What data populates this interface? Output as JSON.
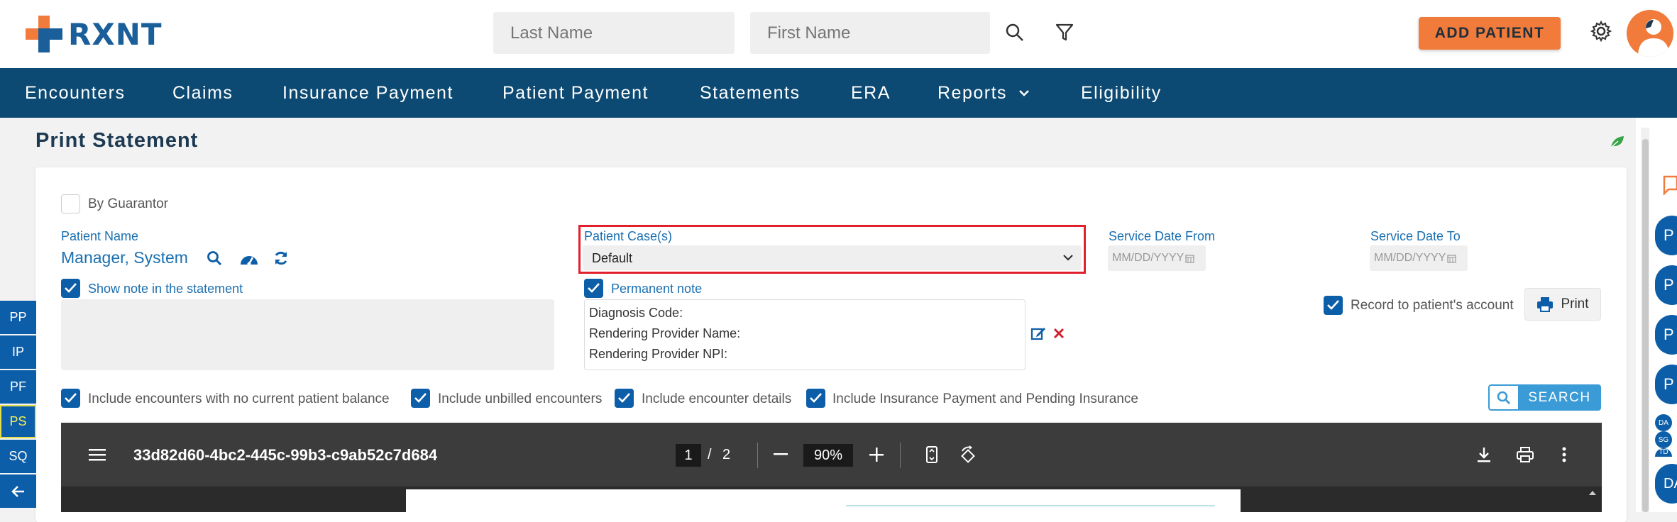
{
  "header": {
    "logo_text": "RXNT",
    "last_name_placeholder": "Last Name",
    "first_name_placeholder": "First Name",
    "add_patient_label": "ADD PATIENT"
  },
  "nav": {
    "items": [
      "Encounters",
      "Claims",
      "Insurance Payment",
      "Patient Payment",
      "Statements",
      "ERA",
      "Reports",
      "Eligibility"
    ]
  },
  "page": {
    "title": "Print Statement"
  },
  "form": {
    "by_guarantor_label": "By Guarantor",
    "patient_name_label": "Patient Name",
    "patient_name_value": "Manager, System",
    "patient_cases_label": "Patient Case(s)",
    "patient_cases_value": "Default",
    "service_date_from_label": "Service Date From",
    "service_date_from_placeholder": "MM/DD/YYYY",
    "service_date_to_label": "Service Date To",
    "service_date_to_placeholder": "MM/DD/YYYY",
    "show_note_label": "Show note in the statement",
    "permanent_note_label": "Permanent note",
    "note_lines": [
      "Diagnosis Code:",
      "Rendering Provider Name:",
      "Rendering Provider NPI:"
    ],
    "record_to_account_label": "Record to patient's account",
    "print_label": "Print",
    "options": [
      "Include encounters with no current patient balance",
      "Include unbilled encounters",
      "Include encounter details",
      "Include Insurance Payment and Pending Insurance"
    ],
    "search_label": "SEARCH"
  },
  "pdf_viewer": {
    "file_name": "33d82d60-4bc2-445c-99b3-c9ab52c7d684",
    "current_page": "1",
    "page_separator": "/",
    "total_pages": "2",
    "zoom": "90%"
  },
  "side_tabs": [
    "PP",
    "IP",
    "PF",
    "PS",
    "SQ"
  ],
  "right_rail": {
    "circles": [
      "P",
      "P",
      "P",
      "P",
      "DA"
    ],
    "mini": [
      "DA",
      "SG",
      "TD"
    ]
  },
  "colors": {
    "brand_blue": "#0d4a73",
    "accent_orange": "#f07b3a",
    "checkbox_blue": "#0d5ea8",
    "highlight_red": "#e0202b"
  }
}
